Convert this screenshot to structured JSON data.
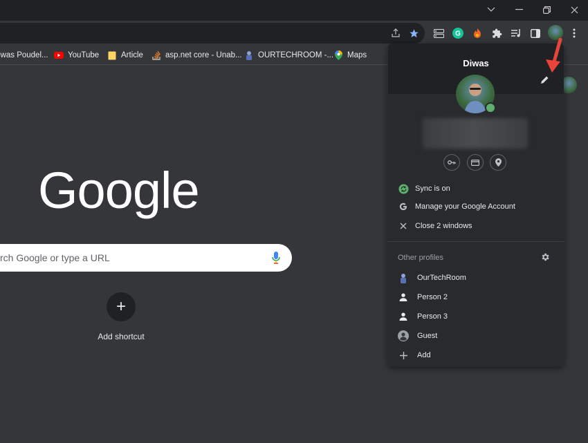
{
  "window": {
    "controls": [
      "chevron-down",
      "minimize",
      "restore",
      "close"
    ]
  },
  "toolbar": {
    "icons": [
      "share-icon",
      "star-icon",
      "tab-search-icon",
      "grammarly-icon",
      "fire-extension-icon",
      "extensions-icon",
      "reading-list-icon",
      "side-panel-icon",
      "profile-avatar",
      "menu-icon"
    ],
    "accent": "#8ab4f8"
  },
  "bookmarks": [
    {
      "label": "iwas Poudel...",
      "icon": "bookmark-icon"
    },
    {
      "label": "YouTube",
      "icon": "youtube-icon"
    },
    {
      "label": "Article",
      "icon": "folder-icon"
    },
    {
      "label": "asp.net core - Unab...",
      "icon": "stackoverflow-icon"
    },
    {
      "label": "OURTECHROOM -...",
      "icon": "ourtechroom-icon"
    },
    {
      "label": "Maps",
      "icon": "maps-icon"
    }
  ],
  "newtab": {
    "logo": "Google",
    "search_placeholder": "rch Google or type a URL",
    "shortcut_label": "Add shortcut",
    "shortcut_symbol": "+"
  },
  "profile_panel": {
    "name": "Diwas",
    "actions": [
      {
        "label": "Sync is on",
        "icon": "sync-icon"
      },
      {
        "label": "Manage your Google Account",
        "icon": "google-g-icon"
      },
      {
        "label": "Close 2 windows",
        "icon": "close-icon"
      }
    ],
    "other_profiles_label": "Other profiles",
    "profiles": [
      {
        "label": "OurTechRoom",
        "icon": "ourtechroom-avatar-icon"
      },
      {
        "label": "Person 2",
        "icon": "person-icon"
      },
      {
        "label": "Person 3",
        "icon": "person-icon"
      },
      {
        "label": "Guest",
        "icon": "guest-icon"
      },
      {
        "label": "Add",
        "icon": "add-icon"
      }
    ],
    "sync_color": "#5fae6e"
  },
  "annotation": {
    "color": "#e8443a"
  }
}
